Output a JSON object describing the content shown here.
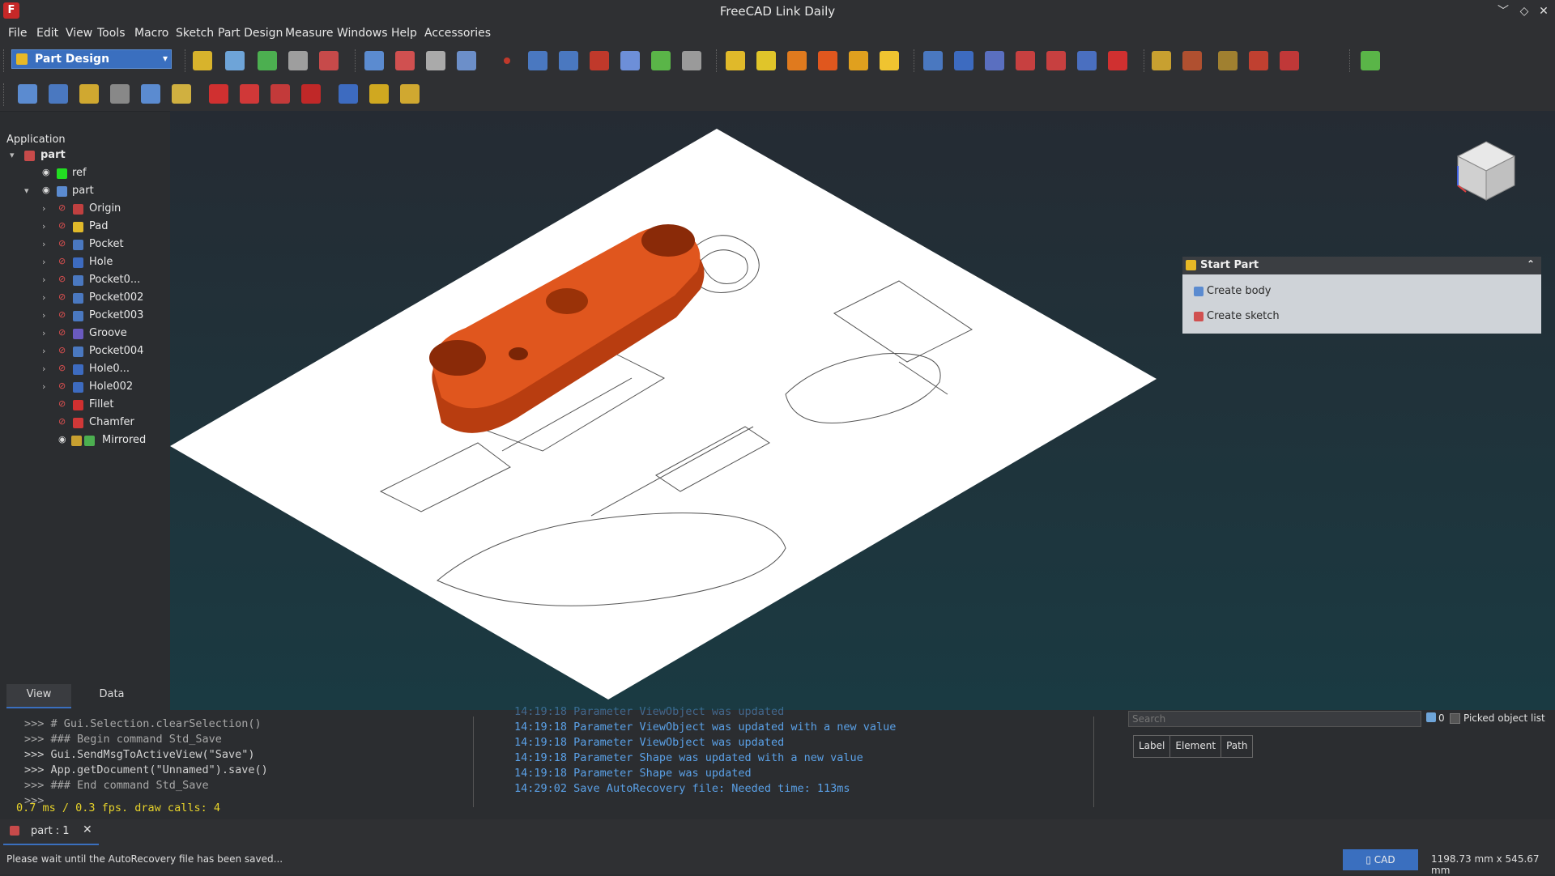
{
  "window": {
    "title": "FreeCAD Link Daily"
  },
  "menu": [
    "File",
    "Edit",
    "View",
    "Tools",
    "Macro",
    "Sketch",
    "Part Design",
    "Measure",
    "Windows",
    "Help",
    "Accessories"
  ],
  "workbench": {
    "selected": "Part Design"
  },
  "tree": {
    "header": "Application",
    "root": "part",
    "items": [
      {
        "label": "ref"
      },
      {
        "label": "part"
      },
      {
        "label": "Origin"
      },
      {
        "label": "Pad"
      },
      {
        "label": "Pocket"
      },
      {
        "label": "Hole"
      },
      {
        "label": "Pocket0..."
      },
      {
        "label": "Pocket002"
      },
      {
        "label": "Pocket003"
      },
      {
        "label": "Groove"
      },
      {
        "label": "Pocket004"
      },
      {
        "label": "Hole0..."
      },
      {
        "label": "Hole002"
      },
      {
        "label": "Fillet"
      },
      {
        "label": "Chamfer"
      },
      {
        "label": "Mirrored"
      }
    ]
  },
  "property_tabs": [
    "View",
    "Data"
  ],
  "task_panel": {
    "title": "Start Part",
    "items": [
      "Create body",
      "Create sketch"
    ]
  },
  "python_console": {
    "lines": [
      ">>> # Gui.Selection.clearSelection()",
      ">>> ### Begin command Std_Save",
      ">>> Gui.SendMsgToActiveView(\"Save\")",
      ">>> App.getDocument(\"Unnamed\").save()",
      ">>> ### End command Std_Save",
      ">>>"
    ],
    "perf": "0.7 ms / 0.3 fps. draw calls: 4"
  },
  "report_view": {
    "partial_line": "14:19:18  Parameter ViewObject was updated",
    "lines": [
      {
        "time": "14:19:18",
        "msg": "Parameter ViewObject was updated with a new value"
      },
      {
        "time": "14:19:18",
        "msg": "Parameter ViewObject was updated"
      },
      {
        "time": "14:19:18",
        "msg": "Parameter Shape was updated with a new value"
      },
      {
        "time": "14:19:18",
        "msg": "Parameter Shape was updated"
      },
      {
        "time": "14:29:02",
        "msg": "Save AutoRecovery file: Needed time: 113ms"
      }
    ]
  },
  "selection_view": {
    "search_placeholder": "Search",
    "count": "0",
    "picked_label": "Picked object list",
    "columns": [
      "Label",
      "Element",
      "Path"
    ]
  },
  "doc_tab": {
    "label": "part : 1"
  },
  "status": {
    "message": "Please wait until the AutoRecovery file has been saved...",
    "nav_style": "CAD",
    "dimensions": "1198.73 mm x 545.67 mm"
  },
  "colors": {
    "accent": "#3a6fbf",
    "model": "#e0561e",
    "report_text": "#5aa0e6",
    "perf_text": "#e6d22a"
  }
}
